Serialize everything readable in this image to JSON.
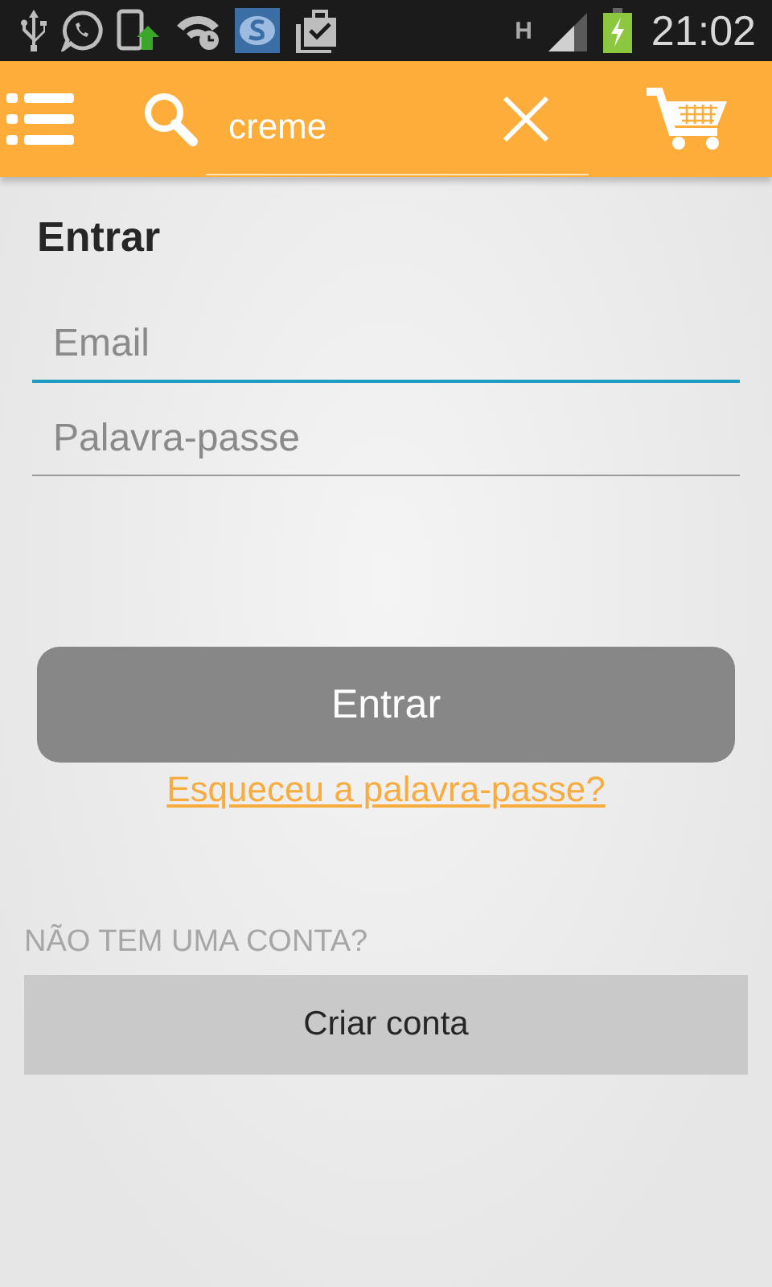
{
  "status_bar": {
    "network": "H",
    "time": "21:02"
  },
  "toolbar": {
    "search": {
      "value": "creme"
    }
  },
  "login": {
    "title": "Entrar",
    "fields": [
      {
        "placeholder": "Email",
        "selected": true
      },
      {
        "placeholder": "Palavra-passe",
        "selected": false
      }
    ],
    "submit": "Entrar",
    "forgot_link": "Esqueceu a palavra-passe?"
  },
  "signup": {
    "prompt": "NÃO TEM UMA CONTA?",
    "button": "Criar conta"
  }
}
